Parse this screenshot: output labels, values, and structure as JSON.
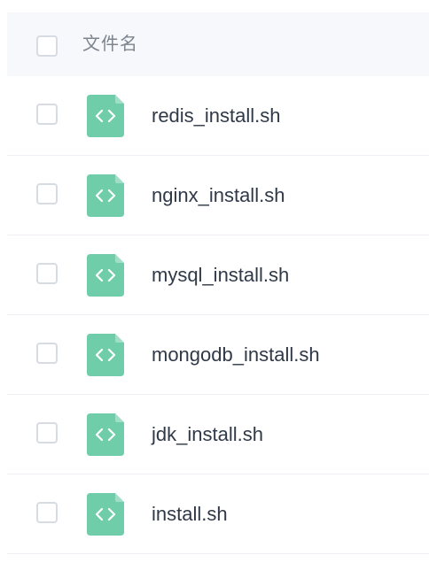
{
  "header": {
    "column_label": "文件名"
  },
  "files": [
    {
      "name": "redis_install.sh",
      "icon": "code-file-icon"
    },
    {
      "name": "nginx_install.sh",
      "icon": "code-file-icon"
    },
    {
      "name": "mysql_install.sh",
      "icon": "code-file-icon"
    },
    {
      "name": "mongodb_install.sh",
      "icon": "code-file-icon"
    },
    {
      "name": "jdk_install.sh",
      "icon": "code-file-icon"
    },
    {
      "name": "install.sh",
      "icon": "code-file-icon"
    }
  ],
  "colors": {
    "icon_green": "#6fcda9",
    "header_background": "#f6f8fc",
    "text": "#2f3947"
  }
}
